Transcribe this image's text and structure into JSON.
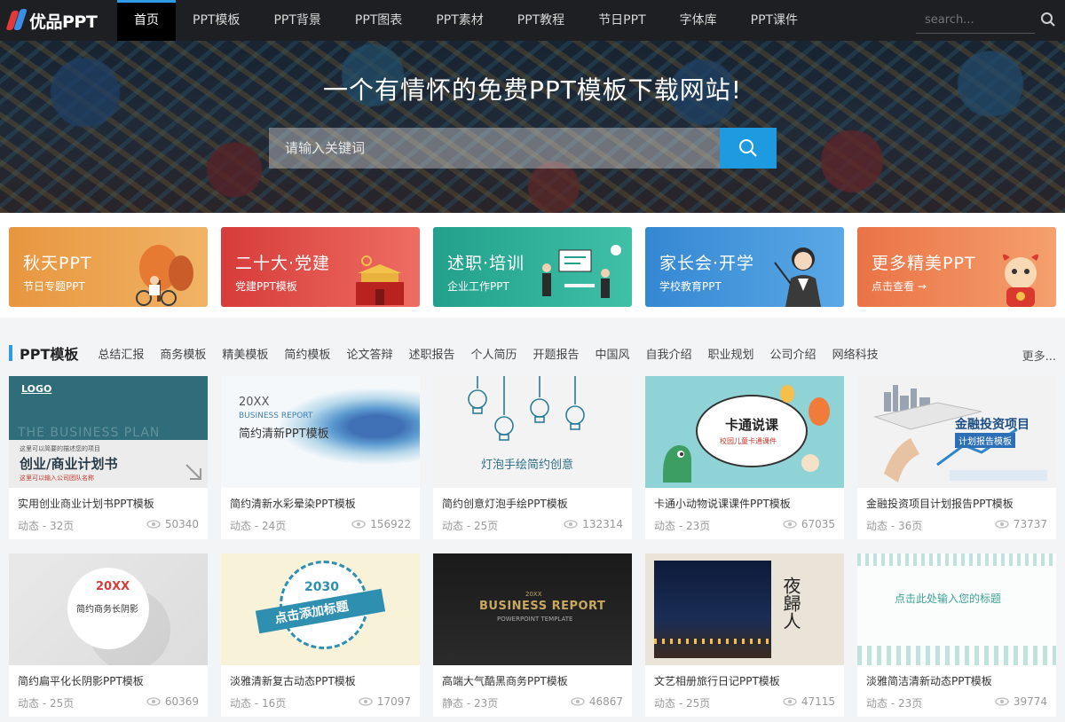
{
  "nav": {
    "logo": "优品PPT",
    "items": [
      "首页",
      "PPT模板",
      "PPT背景",
      "PPT图表",
      "PPT素材",
      "PPT教程",
      "节日PPT",
      "字体库",
      "PPT课件"
    ],
    "search_placeholder": "search..."
  },
  "hero": {
    "title": "一个有情怀的免费PPT模板下载网站!",
    "search_placeholder": "请输入关键词"
  },
  "banners": [
    {
      "title": "秋天PPT",
      "sub": "节日专题PPT",
      "color": "#e69a45"
    },
    {
      "title": "二十大·党建",
      "sub": "党建PPT模板",
      "color": "#d9453f"
    },
    {
      "title": "述职·培训",
      "sub": "企业工作PPT",
      "color": "#2aa38f"
    },
    {
      "title": "家长会·开学",
      "sub": "学校教育PPT",
      "color": "#3f8fd4"
    },
    {
      "title": "更多精美PPT",
      "sub": "点击查看 →",
      "color": "#ec7a4d"
    }
  ],
  "section": {
    "title": "PPT模板",
    "categories": [
      "总结汇报",
      "商务模板",
      "精美模板",
      "简约模板",
      "论文答辩",
      "述职报告",
      "个人简历",
      "开题报告",
      "中国风",
      "自我介绍",
      "职业规划",
      "公司介绍",
      "网络科技"
    ],
    "more": "更多..."
  },
  "cards": [
    {
      "title": "实用创业商业计划书PPT模板",
      "meta": "动态 - 32页",
      "views": "50340",
      "thumb": {
        "logo": "LOGO",
        "bg_text": "THE BUSINESS PLAN",
        "small": "这里可以简要的描述您的项目",
        "main": "创业/商业计划书",
        "foot": "这里可以输入公司团队名称"
      }
    },
    {
      "title": "简约清新水彩晕染PPT模板",
      "meta": "动态 - 24页",
      "views": "156922",
      "thumb": {
        "year": "20XX",
        "sub": "BUSINESS REPORT",
        "main": "简约清新PPT模板"
      }
    },
    {
      "title": "简约创意灯泡手绘PPT模板",
      "meta": "动态 - 25页",
      "views": "132314",
      "thumb": {
        "main": "灯泡手绘简约创意"
      }
    },
    {
      "title": "卡通小动物说课课件PPT模板",
      "meta": "动态 - 23页",
      "views": "67035",
      "thumb": {
        "main": "卡通说课",
        "sub": "校园儿童卡通课件"
      }
    },
    {
      "title": "金融投资项目计划报告PPT模板",
      "meta": "动态 - 36页",
      "views": "73737",
      "thumb": {
        "main": "金融投资项目",
        "sub": "计划报告模板"
      }
    },
    {
      "title": "简约扁平化长阴影PPT模板",
      "meta": "动态 - 25页",
      "views": "60369",
      "thumb": {
        "year": "20XX",
        "main": "简约商务长阴影"
      }
    },
    {
      "title": "淡雅清新复古动态PPT模板",
      "meta": "动态 - 16页",
      "views": "17097",
      "thumb": {
        "year": "2030",
        "main": "点击添加标题"
      }
    },
    {
      "title": "高端大气酷黑商务PPT模板",
      "meta": "静态 - 23页",
      "views": "46867",
      "thumb": {
        "year": "20XX",
        "main": "BUSINESS REPORT",
        "sub": "POWERPOINT TEMPLATE"
      }
    },
    {
      "title": "文艺相册旅行日记PPT模板",
      "meta": "动态 - 25页",
      "views": "47115",
      "thumb": {
        "main": "夜歸人"
      }
    },
    {
      "title": "淡雅简洁清新动态PPT模板",
      "meta": "动态 - 23页",
      "views": "39774",
      "thumb": {
        "main": "点击此处输入您的标题"
      }
    }
  ],
  "colors": {
    "accent": "#2f9ae5",
    "nav_bg": "#1d1f22",
    "search_btn": "#1e9be0"
  }
}
